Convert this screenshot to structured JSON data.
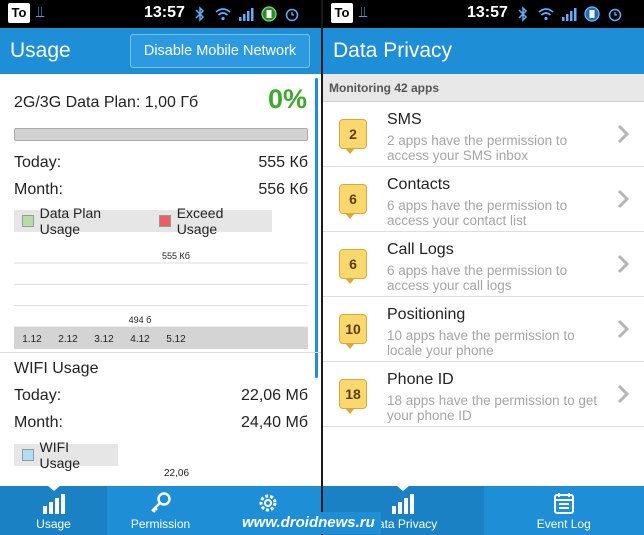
{
  "left": {
    "status": {
      "time": "13:57",
      "logo": "To"
    },
    "appbar": {
      "title": "Usage",
      "disable_button": "Disable Mobile Network"
    },
    "plan": {
      "label": "2G/3G Data Plan: 1,00 Гб",
      "percent": "0%",
      "progress": 0
    },
    "mobile": {
      "today_label": "Today:",
      "today_value": "555 Кб",
      "month_label": "Month:",
      "month_value": "556 Кб"
    },
    "legend": {
      "plan_label": "Data Plan Usage",
      "exceed_label": "Exceed Usage"
    },
    "chart_data": {
      "type": "bar",
      "categories": [
        "1.12",
        "2.12",
        "3.12",
        "4.12",
        "5.12"
      ],
      "values": [
        0,
        0,
        0,
        0.494,
        555
      ],
      "labels": [
        "",
        "",
        "",
        "494 б",
        "555 Кб"
      ],
      "colors": {
        "plan": "#b8dca8",
        "exceed": "#e86060",
        "wifi": "#aee0f4"
      }
    },
    "wifi": {
      "title": "WIFI Usage",
      "today_label": "Today:",
      "today_value": "22,06 Мб",
      "month_label": "Month:",
      "month_value": "24,40 Мб",
      "legend_label": "WIFI Usage",
      "chart_top_label": "22,06"
    },
    "nav": [
      {
        "label": "Usage",
        "icon": "bar-chart-icon",
        "active": true
      },
      {
        "label": "Permission",
        "icon": "key-icon",
        "active": false
      },
      {
        "label": "S",
        "icon": "gear-icon",
        "active": false
      }
    ]
  },
  "right": {
    "status": {
      "time": "13:57",
      "logo": "To"
    },
    "appbar": {
      "title": "Data Privacy"
    },
    "subheader": "Monitoring 42 apps",
    "items": [
      {
        "count": "2",
        "title": "SMS",
        "desc": "2 apps have the permission to access your SMS inbox"
      },
      {
        "count": "6",
        "title": "Contacts",
        "desc": "6 apps have the permission to access your contact list"
      },
      {
        "count": "6",
        "title": "Call Logs",
        "desc": "6 apps have the permission to access your call logs"
      },
      {
        "count": "10",
        "title": "Positioning",
        "desc": "10 apps have the permission to locale your phone"
      },
      {
        "count": "18",
        "title": "Phone ID",
        "desc": "18 apps have the permission to get your phone ID"
      }
    ],
    "nav": [
      {
        "label": "Data Privacy",
        "icon": "bar-chart-icon",
        "active": true
      },
      {
        "label": "Event Log",
        "icon": "calendar-icon",
        "active": false
      }
    ]
  },
  "watermark": "www.droidnews.ru",
  "colors": {
    "accent": "#1e8fd6",
    "green": "#3caa2c",
    "badge": "#fbd86e"
  }
}
